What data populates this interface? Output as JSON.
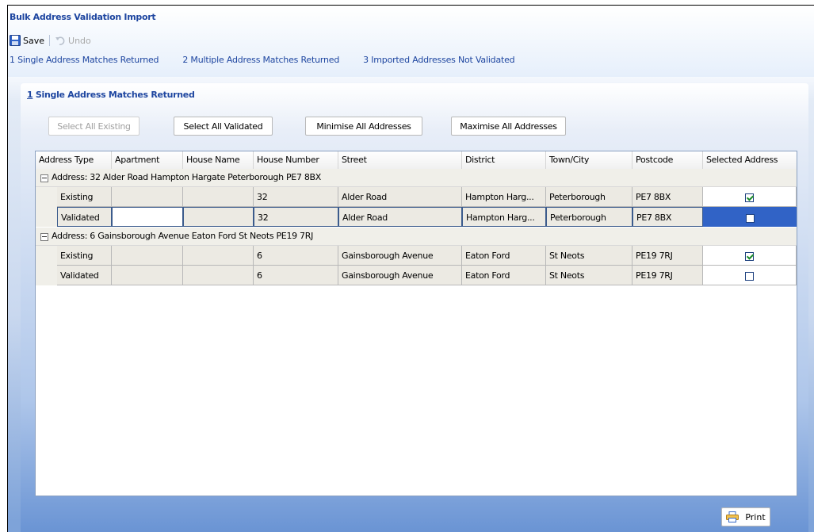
{
  "window": {
    "title": "Bulk Address Validation Import"
  },
  "toolbar": {
    "save_label": "Save",
    "undo_label": "Undo"
  },
  "tabs": [
    {
      "label": "1 Single Address Matches Returned"
    },
    {
      "label": "2 Multiple Address Matches Returned"
    },
    {
      "label": "3 Imported Addresses Not Validated"
    }
  ],
  "section": {
    "num": "1",
    "title": " Single Address Matches Returned"
  },
  "buttons": {
    "select_all_existing": "Select All Existing",
    "select_all_validated": "Select All Validated",
    "minimise_all": "Minimise All Addresses",
    "maximise_all": "Maximise All Addresses",
    "print": "Print"
  },
  "grid": {
    "columns": [
      "Address Type",
      "Apartment",
      "House Name",
      "House Number",
      "Street",
      "District",
      "Town/City",
      "Postcode",
      "Selected Address"
    ],
    "groups": [
      {
        "label": "Address:  32 Alder Road Hampton Hargate Peterborough PE7 8BX",
        "rows": [
          {
            "type": "Existing",
            "apartment": "",
            "house_name": "",
            "house_number": "32",
            "street": "Alder Road",
            "district": "Hampton Harg...",
            "town": "Peterborough",
            "postcode": "PE7 8BX",
            "selected": true
          },
          {
            "type": "Validated",
            "apartment": "",
            "house_name": "",
            "house_number": "32",
            "street": "Alder Road",
            "district": "Hampton Harg...",
            "town": "Peterborough",
            "postcode": "PE7 8BX",
            "selected": false
          }
        ]
      },
      {
        "label": "Address:  6 Gainsborough Avenue Eaton Ford St Neots PE19 7RJ",
        "rows": [
          {
            "type": "Existing",
            "apartment": "",
            "house_name": "",
            "house_number": "6",
            "street": "Gainsborough Avenue",
            "district": "Eaton Ford",
            "town": "St Neots",
            "postcode": "PE19 7RJ",
            "selected": true
          },
          {
            "type": "Validated",
            "apartment": "",
            "house_name": "",
            "house_number": "6",
            "street": "Gainsborough Avenue",
            "district": "Eaton Ford",
            "town": "St Neots",
            "postcode": "PE19 7RJ",
            "selected": false
          }
        ]
      }
    ]
  },
  "colors": {
    "link_blue": "#1e46a0",
    "selection": "#3163c6"
  }
}
